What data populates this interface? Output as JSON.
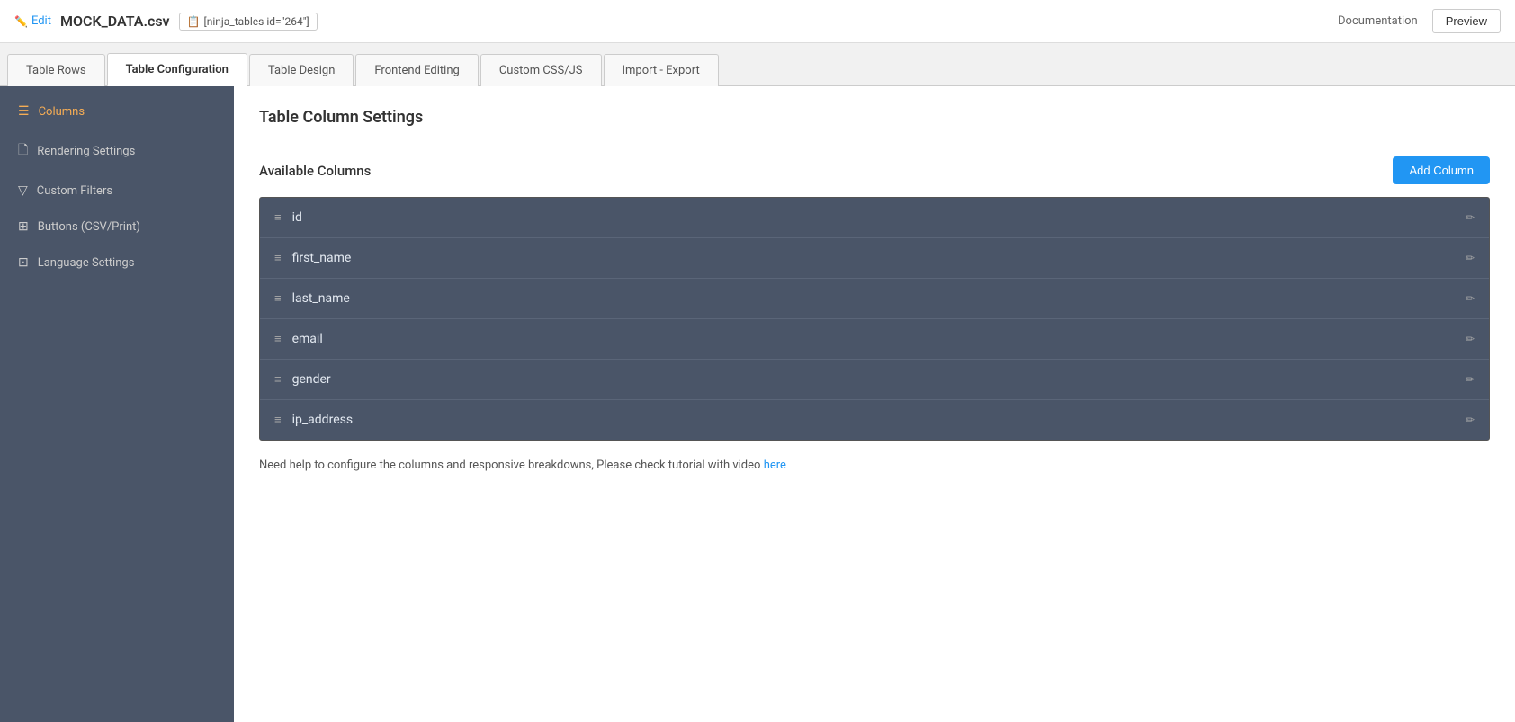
{
  "header": {
    "edit_label": "Edit",
    "file_name": "MOCK_DATA.csv",
    "shortcode": "[ninja_tables id=\"264\"]",
    "doc_label": "Documentation",
    "preview_label": "Preview"
  },
  "tabs": [
    {
      "id": "table-rows",
      "label": "Table Rows",
      "active": false
    },
    {
      "id": "table-configuration",
      "label": "Table Configuration",
      "active": true
    },
    {
      "id": "table-design",
      "label": "Table Design",
      "active": false
    },
    {
      "id": "frontend-editing",
      "label": "Frontend Editing",
      "active": false
    },
    {
      "id": "custom-css-js",
      "label": "Custom CSS/JS",
      "active": false
    },
    {
      "id": "import-export",
      "label": "Import - Export",
      "active": false
    }
  ],
  "sidebar": {
    "items": [
      {
        "id": "columns",
        "label": "Columns",
        "icon": "☰",
        "active": true
      },
      {
        "id": "rendering-settings",
        "label": "Rendering Settings",
        "icon": "📄",
        "active": false
      },
      {
        "id": "custom-filters",
        "label": "Custom Filters",
        "icon": "▼",
        "active": false
      },
      {
        "id": "buttons-csv-print",
        "label": "Buttons (CSV/Print)",
        "icon": "⊞",
        "active": false
      },
      {
        "id": "language-settings",
        "label": "Language Settings",
        "icon": "⊡",
        "active": false
      }
    ]
  },
  "content": {
    "section_title": "Table Column Settings",
    "available_columns_label": "Available Columns",
    "add_column_label": "Add Column",
    "columns": [
      {
        "name": "id"
      },
      {
        "name": "first_name"
      },
      {
        "name": "last_name"
      },
      {
        "name": "email"
      },
      {
        "name": "gender"
      },
      {
        "name": "ip_address"
      }
    ],
    "help_text": "Need help to configure the columns and responsive breakdowns, Please check tutorial with video",
    "help_link_text": "here",
    "help_link_url": "#"
  }
}
